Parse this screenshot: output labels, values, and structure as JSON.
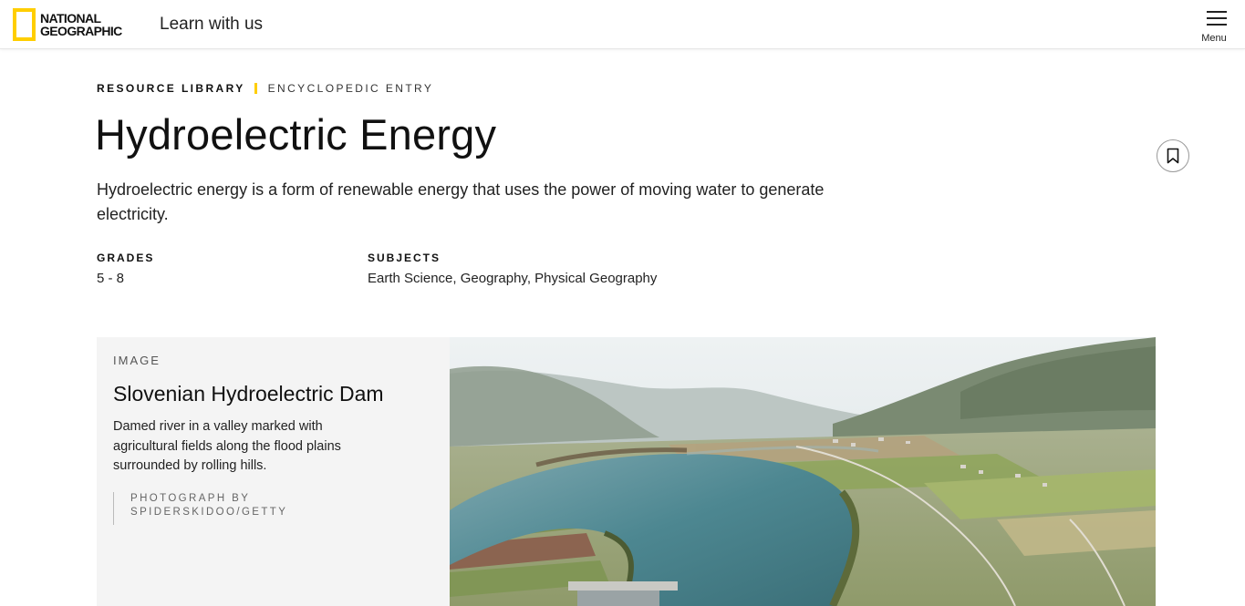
{
  "header": {
    "logo_line1": "NATIONAL",
    "logo_line2": "GEOGRAPHIC",
    "tagline": "Learn with us",
    "menu_label": "Menu"
  },
  "breadcrumb": {
    "section": "RESOURCE LIBRARY",
    "type": "ENCYCLOPEDIC ENTRY"
  },
  "article": {
    "title": "Hydroelectric Energy",
    "description": "Hydroelectric energy is a form of renewable energy that uses the power of moving water to generate electricity.",
    "grades_label": "GRADES",
    "grades_value": "5 - 8",
    "subjects_label": "SUBJECTS",
    "subjects_value": "Earth Science, Geography, Physical Geography"
  },
  "image_card": {
    "kicker": "IMAGE",
    "title": "Slovenian Hydroelectric Dam",
    "description": "Damed river in a valley marked with agricultural fields along the flood plains surrounded by rolling hills.",
    "credit_line1": "PHOTOGRAPH BY",
    "credit_line2": "SPIDERSKIDOO/GETTY"
  },
  "colors": {
    "brand_yellow": "#FFCE00",
    "card_bg": "#f4f4f4"
  },
  "icons": [
    "hamburger-menu-icon",
    "bookmark-icon"
  ]
}
